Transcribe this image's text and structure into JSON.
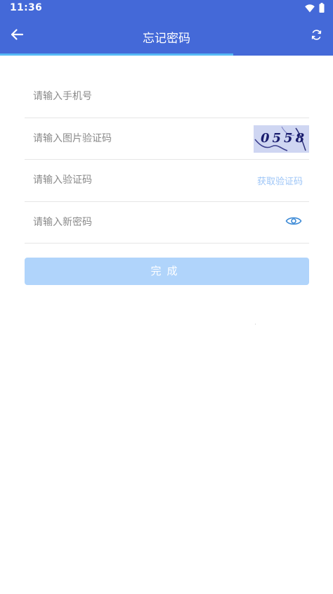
{
  "status_bar": {
    "time": "11:36"
  },
  "app_bar": {
    "title": "忘记密码"
  },
  "progress": {
    "fraction": 0.7
  },
  "form": {
    "phone_placeholder": "请输入手机号",
    "captcha_placeholder": "请输入图片验证码",
    "captcha_text": "0558",
    "sms_code_placeholder": "请输入验证码",
    "get_code_label": "获取验证码",
    "new_password_placeholder": "请输入新密码"
  },
  "submit": {
    "label": "完成"
  },
  "colors": {
    "primary": "#4469d8",
    "progress": "#56b9f5",
    "submit_disabled": "#b0d4fb",
    "link": "#9ec6f7",
    "eye_icon": "#3c8ad6"
  }
}
